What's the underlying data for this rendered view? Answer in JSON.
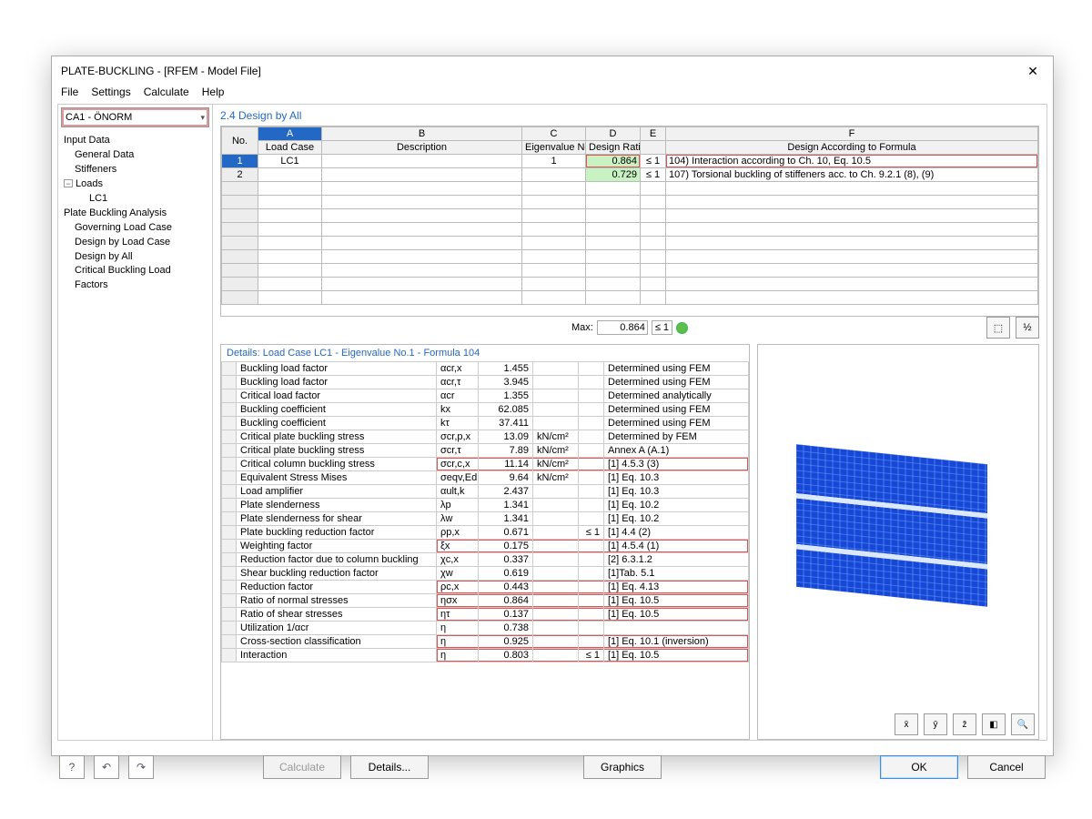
{
  "window": {
    "title": "PLATE-BUCKLING - [RFEM - Model File]"
  },
  "menu": {
    "file": "File",
    "settings": "Settings",
    "calculate": "Calculate",
    "help": "Help"
  },
  "combo": {
    "value": "CA1 - ÖNORM"
  },
  "tree": {
    "n0": "Input Data",
    "n1": "General Data",
    "n2": "Stiffeners",
    "n3": "Loads",
    "n4": "LC1",
    "n5": "Plate Buckling Analysis",
    "n6": "Governing Load Case",
    "n7": "Design by Load Case",
    "n8": "Design by All",
    "n9": "Critical Buckling Load Factors"
  },
  "section": {
    "title": "2.4 Design by All"
  },
  "grid1": {
    "cols": {
      "A": "A",
      "B": "B",
      "C": "C",
      "D": "D",
      "E": "E",
      "F": "F"
    },
    "h2": {
      "no": "No.",
      "lc": "Load Case",
      "desc": "Description",
      "eig": "Eigenvalue No.",
      "ratio": "Design Ratio",
      "formula": "Design According to Formula"
    },
    "rows": [
      {
        "no": "1",
        "lc": "LC1",
        "desc": "",
        "eig": "1",
        "ratio": "0.864",
        "le": "≤ 1",
        "formula": "104) Interaction according to Ch. 10, Eq. 10.5"
      },
      {
        "no": "2",
        "lc": "",
        "desc": "",
        "eig": "",
        "ratio": "0.729",
        "le": "≤ 1",
        "formula": "107) Torsional buckling of stiffeners acc. to Ch. 9.2.1 (8), (9)"
      }
    ],
    "max": {
      "label": "Max:",
      "value": "0.864",
      "le": "≤ 1"
    }
  },
  "details": {
    "title": "Details:  Load Case LC1 - Eigenvalue No.1 - Formula 104",
    "rows": [
      {
        "n": "Buckling load factor",
        "s": "αcr,x",
        "v": "1.455",
        "u": "",
        "c": "",
        "r": "Determined using FEM"
      },
      {
        "n": "Buckling load factor",
        "s": "αcr,τ",
        "v": "3.945",
        "u": "",
        "c": "",
        "r": "Determined using FEM"
      },
      {
        "n": "Critical load factor",
        "s": "αcr",
        "v": "1.355",
        "u": "",
        "c": "",
        "r": "Determined analytically"
      },
      {
        "n": "Buckling coefficient",
        "s": "kx",
        "v": "62.085",
        "u": "",
        "c": "",
        "r": "Determined using FEM"
      },
      {
        "n": "Buckling coefficient",
        "s": "kτ",
        "v": "37.411",
        "u": "",
        "c": "",
        "r": "Determined using FEM"
      },
      {
        "n": "Critical plate buckling stress",
        "s": "σcr,p,x",
        "v": "13.09",
        "u": "kN/cm²",
        "c": "",
        "r": "Determined by FEM"
      },
      {
        "n": "Critical plate buckling stress",
        "s": "σcr,τ",
        "v": "7.89",
        "u": "kN/cm²",
        "c": "",
        "r": "Annex A (A.1)"
      },
      {
        "n": "Critical column buckling stress",
        "s": "σcr,c,x",
        "v": "11.14",
        "u": "kN/cm²",
        "c": "",
        "r": "[1] 4.5.3 (3)",
        "hl": true
      },
      {
        "n": "Equivalent Stress Mises",
        "s": "σeqv,Ed",
        "v": "9.64",
        "u": "kN/cm²",
        "c": "",
        "r": "[1] Eq. 10.3"
      },
      {
        "n": "Load amplifier",
        "s": "αult,k",
        "v": "2.437",
        "u": "",
        "c": "",
        "r": "[1] Eq. 10.3"
      },
      {
        "n": "Plate slenderness",
        "s": "λp",
        "v": "1.341",
        "u": "",
        "c": "",
        "r": "[1] Eq. 10.2"
      },
      {
        "n": "Plate slenderness for shear",
        "s": "λw",
        "v": "1.341",
        "u": "",
        "c": "",
        "r": "[1] Eq. 10.2"
      },
      {
        "n": "Plate buckling reduction factor",
        "s": "ρp,x",
        "v": "0.671",
        "u": "",
        "c": "≤ 1",
        "r": "[1] 4.4 (2)"
      },
      {
        "n": "Weighting factor",
        "s": "ξx",
        "v": "0.175",
        "u": "",
        "c": "",
        "r": "[1] 4.5.4 (1)",
        "hl": true
      },
      {
        "n": "Reduction factor due to column buckling",
        "s": "χc,x",
        "v": "0.337",
        "u": "",
        "c": "",
        "r": "[2] 6.3.1.2"
      },
      {
        "n": "Shear buckling reduction factor",
        "s": "χw",
        "v": "0.619",
        "u": "",
        "c": "",
        "r": "[1]Tab. 5.1"
      },
      {
        "n": "Reduction factor",
        "s": "ρc,x",
        "v": "0.443",
        "u": "",
        "c": "",
        "r": "[1] Eq. 4.13",
        "hl": true
      },
      {
        "n": "Ratio of normal stresses",
        "s": "ησx",
        "v": "0.864",
        "u": "",
        "c": "",
        "r": "[1] Eq. 10.5",
        "hl": true
      },
      {
        "n": "Ratio of shear stresses",
        "s": "ητ",
        "v": "0.137",
        "u": "",
        "c": "",
        "r": "[1] Eq. 10.5",
        "hl": true
      },
      {
        "n": "Utilization 1/αcr",
        "s": "η",
        "v": "0.738",
        "u": "",
        "c": "",
        "r": ""
      },
      {
        "n": "Cross-section classification",
        "s": "η",
        "v": "0.925",
        "u": "",
        "c": "",
        "r": "[1] Eq. 10.1 (inversion)",
        "hl": true
      },
      {
        "n": "Interaction",
        "s": "η",
        "v": "0.803",
        "u": "",
        "c": "≤ 1",
        "r": "[1] Eq. 10.5",
        "hl": true
      }
    ]
  },
  "preview": {
    "btns": {
      "x": "x̄",
      "y": "ȳ",
      "z": "z̄",
      "iso": "◧",
      "view": "🔍"
    }
  },
  "footer": {
    "calculate": "Calculate",
    "details": "Details...",
    "graphics": "Graphics",
    "ok": "OK",
    "cancel": "Cancel"
  },
  "toolbtn": {
    "a": "⬚",
    "b": "½"
  }
}
